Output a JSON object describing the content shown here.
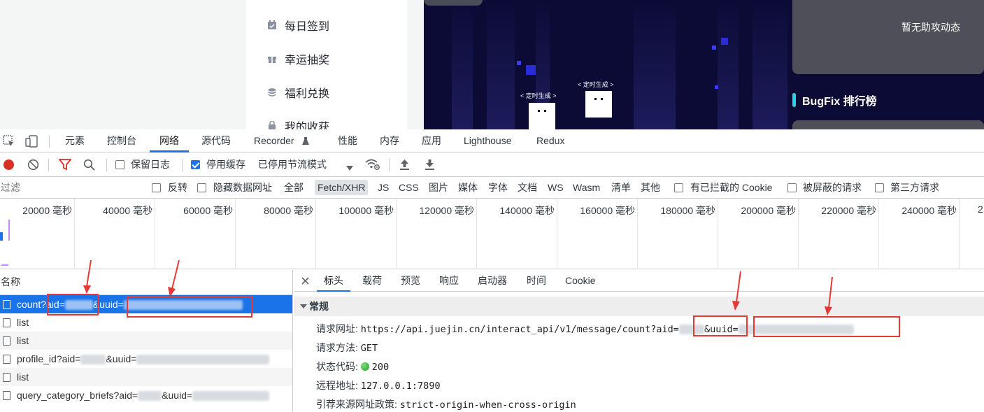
{
  "page": {
    "menu": [
      {
        "icon": "calendar-check-icon",
        "label": "每日签到"
      },
      {
        "icon": "gift-icon",
        "label": "幸运抽奖"
      },
      {
        "icon": "coins-icon",
        "label": "福利兑换"
      },
      {
        "icon": "bookmark-icon",
        "label": "我的收获"
      }
    ],
    "bot_label_1": "< 定时生成 >",
    "bot_label_2": "< 定时生成 >",
    "right_panel": {
      "aid_text": "暂无助攻动态",
      "bugfix_title": "BugFix 排行榜"
    }
  },
  "devtools": {
    "tabs": [
      "元素",
      "控制台",
      "网络",
      "源代码",
      "Recorder",
      "性能",
      "内存",
      "应用",
      "Lighthouse",
      "Redux"
    ],
    "active_tab": "网络",
    "toolbar": {
      "preserve_log": "保留日志",
      "disable_cache": "停用缓存",
      "throttle": "已停用节流模式"
    },
    "filter": {
      "placeholder": "过滤",
      "invert": "反转",
      "hide_data_urls": "隐藏数据网址",
      "types": [
        "全部",
        "Fetch/XHR",
        "JS",
        "CSS",
        "图片",
        "媒体",
        "字体",
        "文档",
        "WS",
        "Wasm",
        "清单",
        "其他"
      ],
      "selected_type": "Fetch/XHR",
      "blocked_cookies": "有已拦截的 Cookie",
      "blocked_requests": "被屏蔽的请求",
      "third_party": "第三方请求"
    },
    "timeline_labels": [
      "20000 毫秒",
      "40000 毫秒",
      "60000 毫秒",
      "80000 毫秒",
      "100000 毫秒",
      "120000 毫秒",
      "140000 毫秒",
      "160000 毫秒",
      "180000 毫秒",
      "200000 毫秒",
      "220000 毫秒",
      "240000 毫秒",
      "2"
    ],
    "requests_header": "名称",
    "requests": [
      {
        "name": "count?aid=",
        "mid": "&uuid=",
        "selected": true
      },
      {
        "name": "list",
        "mid": "",
        "selected": false
      },
      {
        "name": "list",
        "mid": "",
        "selected": false
      },
      {
        "name": "profile_id?aid=",
        "mid": "&uuid=",
        "selected": false
      },
      {
        "name": "list",
        "mid": "",
        "selected": false
      },
      {
        "name": "query_category_briefs?aid=",
        "mid": "&uuid=",
        "selected": false
      }
    ],
    "detail_tabs": [
      "标头",
      "载荷",
      "预览",
      "响应",
      "启动器",
      "时间",
      "Cookie"
    ],
    "active_detail_tab": "标头",
    "general": {
      "title": "常规",
      "request_url_label": "请求网址:",
      "request_url_value": "https://api.juejin.cn/interact_api/v1/message/count?aid=",
      "request_url_uuid": "&uuid=",
      "method_label": "请求方法:",
      "method_value": "GET",
      "status_label": "状态代码:",
      "status_value": "200",
      "remote_label": "远程地址:",
      "remote_value": "127.0.0.1:7890",
      "referrer_label": "引荐来源网址政策:",
      "referrer_value": "strict-origin-when-cross-origin"
    }
  }
}
